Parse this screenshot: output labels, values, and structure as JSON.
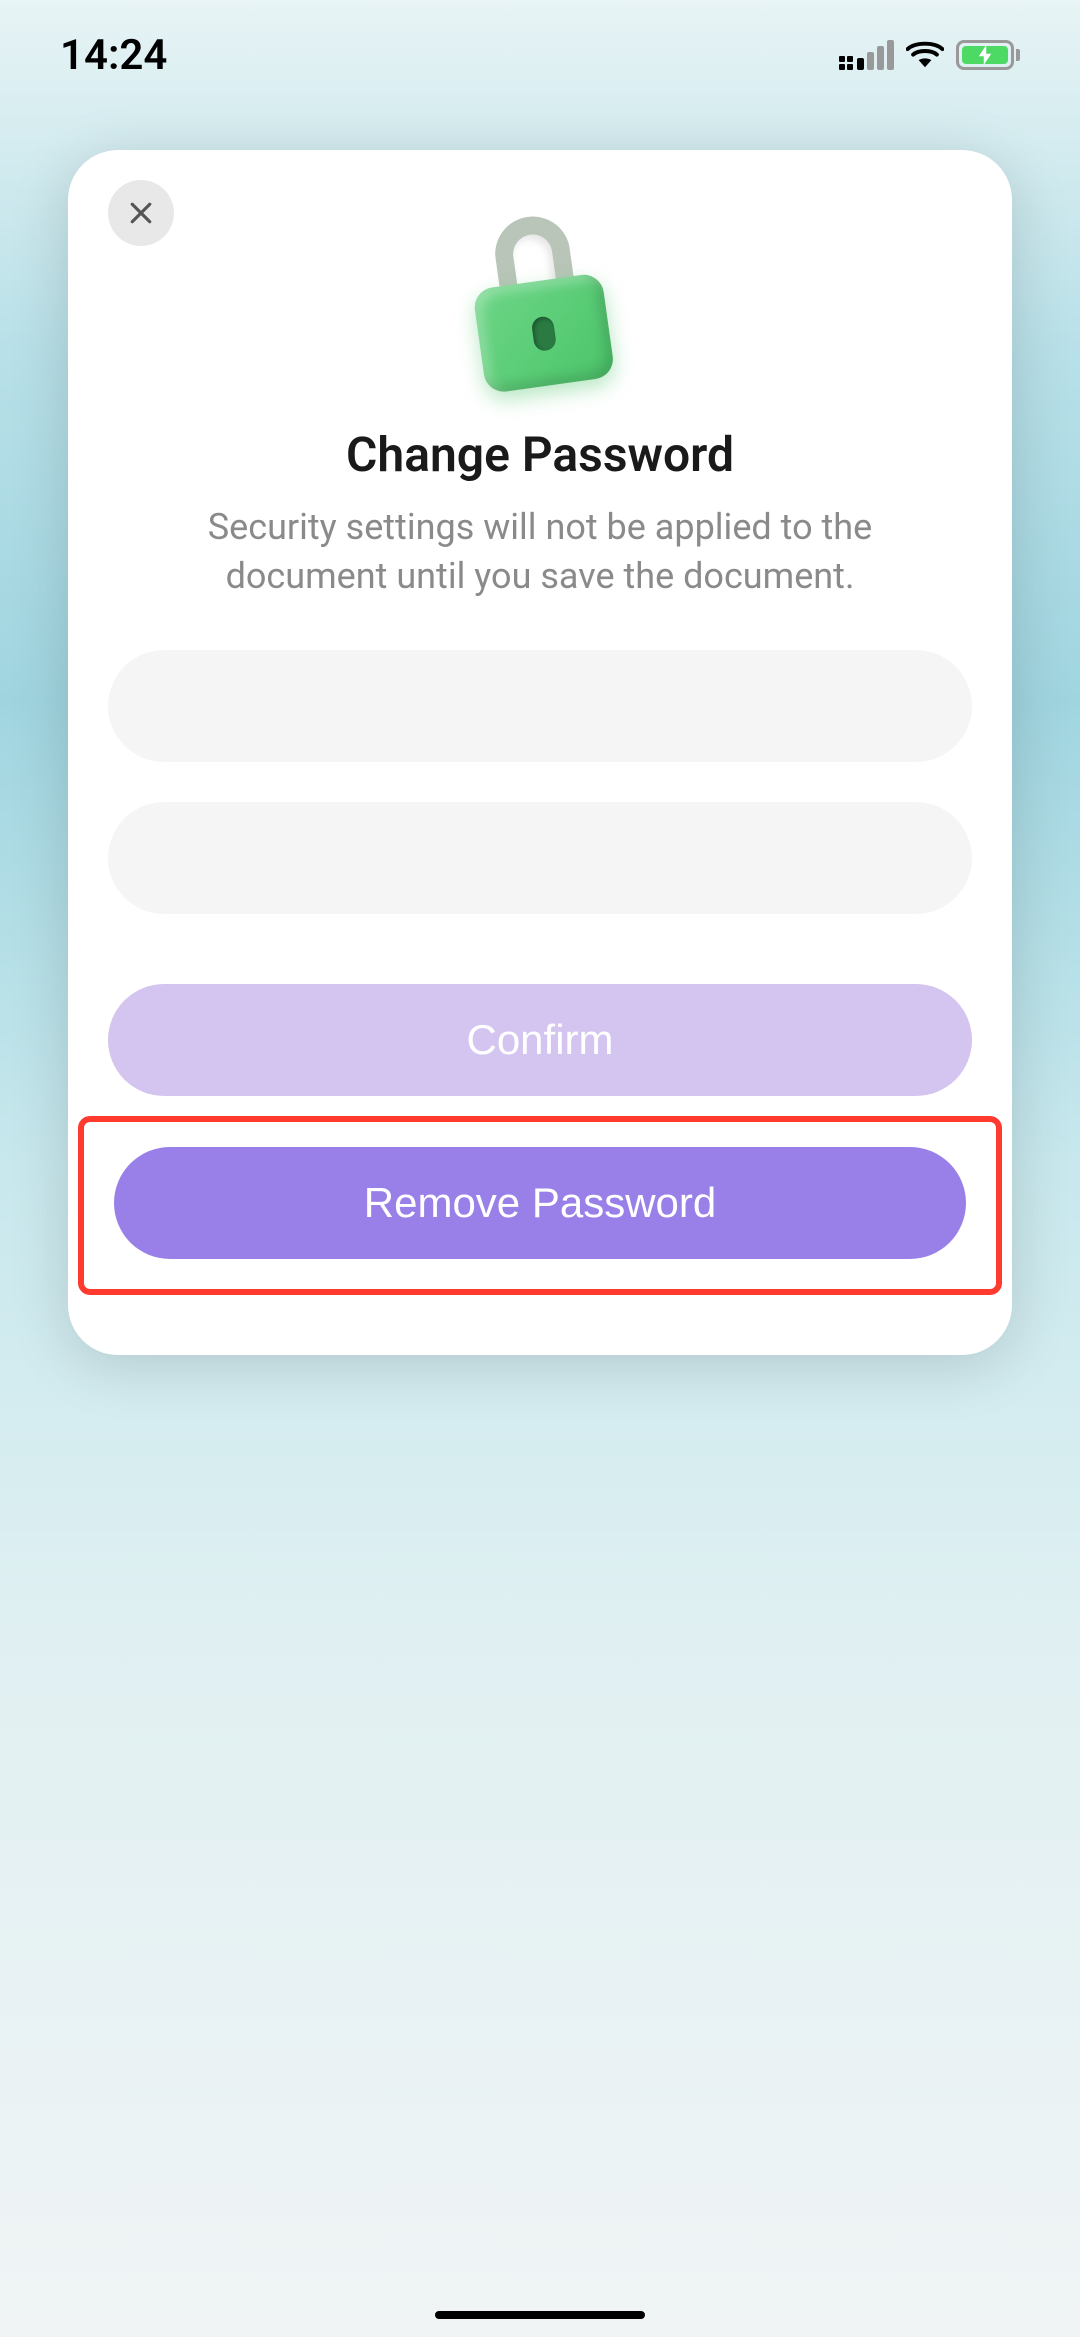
{
  "statusBar": {
    "time": "14:24"
  },
  "modal": {
    "title": "Change Password",
    "subtitle": "Security settings will not be applied to the document until you save the document.",
    "passwordField1": "",
    "passwordField2": "",
    "confirmLabel": "Confirm",
    "removeLabel": "Remove Password"
  }
}
